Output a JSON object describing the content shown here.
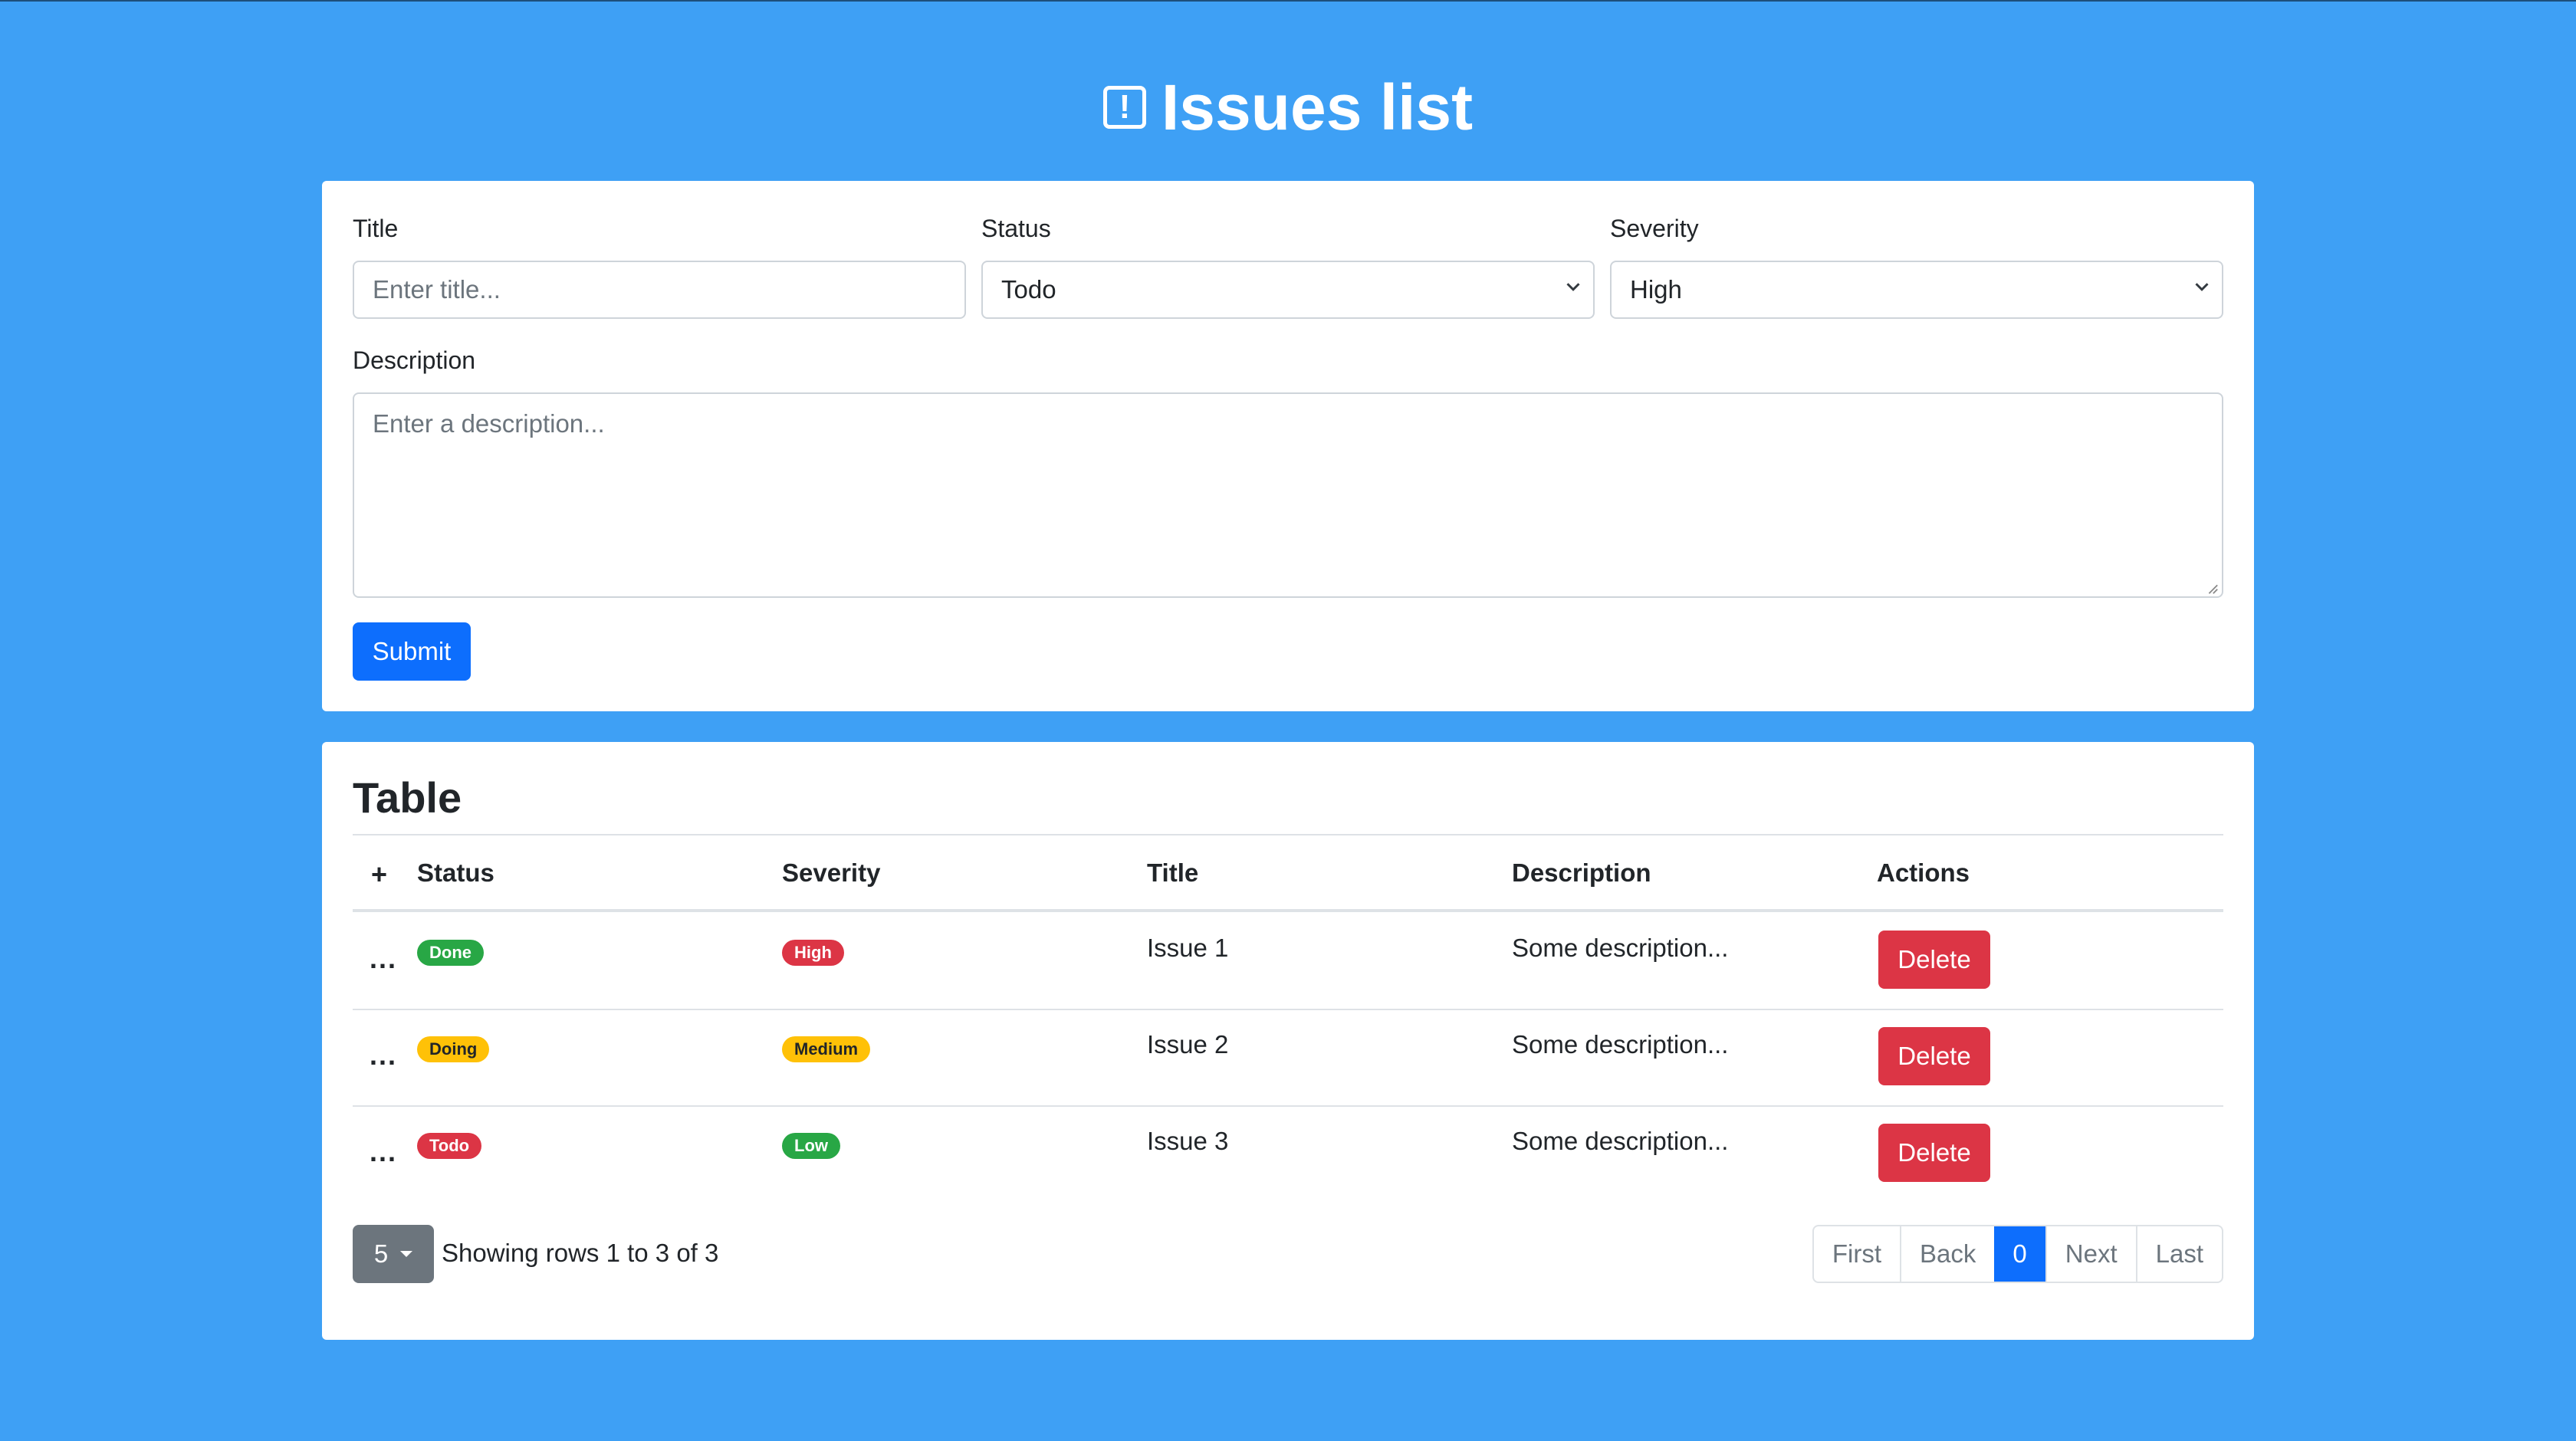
{
  "page": {
    "title": "Issues list"
  },
  "form": {
    "title_label": "Title",
    "title_placeholder": "Enter title...",
    "status_label": "Status",
    "status_value": "Todo",
    "severity_label": "Severity",
    "severity_value": "High",
    "description_label": "Description",
    "description_placeholder": "Enter a description...",
    "submit_label": "Submit"
  },
  "table": {
    "heading": "Table",
    "columns": {
      "add": "+",
      "status": "Status",
      "severity": "Severity",
      "title": "Title",
      "description": "Description",
      "actions": "Actions"
    },
    "rows": [
      {
        "menu": "...",
        "status": "Done",
        "severity": "High",
        "title": "Issue 1",
        "description": "Some description...",
        "action": "Delete"
      },
      {
        "menu": "...",
        "status": "Doing",
        "severity": "Medium",
        "title": "Issue 2",
        "description": "Some description...",
        "action": "Delete"
      },
      {
        "menu": "...",
        "status": "Todo",
        "severity": "Low",
        "title": "Issue 3",
        "description": "Some description...",
        "action": "Delete"
      }
    ]
  },
  "footer": {
    "page_size": "5",
    "showing": "Showing rows 1 to 3 of 3",
    "pagination": {
      "first": "First",
      "back": "Back",
      "current": "0",
      "next": "Next",
      "last": "Last"
    }
  },
  "colors": {
    "background": "#3ea0f5",
    "primary": "#0d6efd",
    "danger": "#dc3545",
    "success": "#28a745",
    "warning": "#ffc107",
    "secondary": "#6c757d"
  },
  "icons": {
    "title": "exclamation-square-icon",
    "select": "chevron-down-icon"
  }
}
